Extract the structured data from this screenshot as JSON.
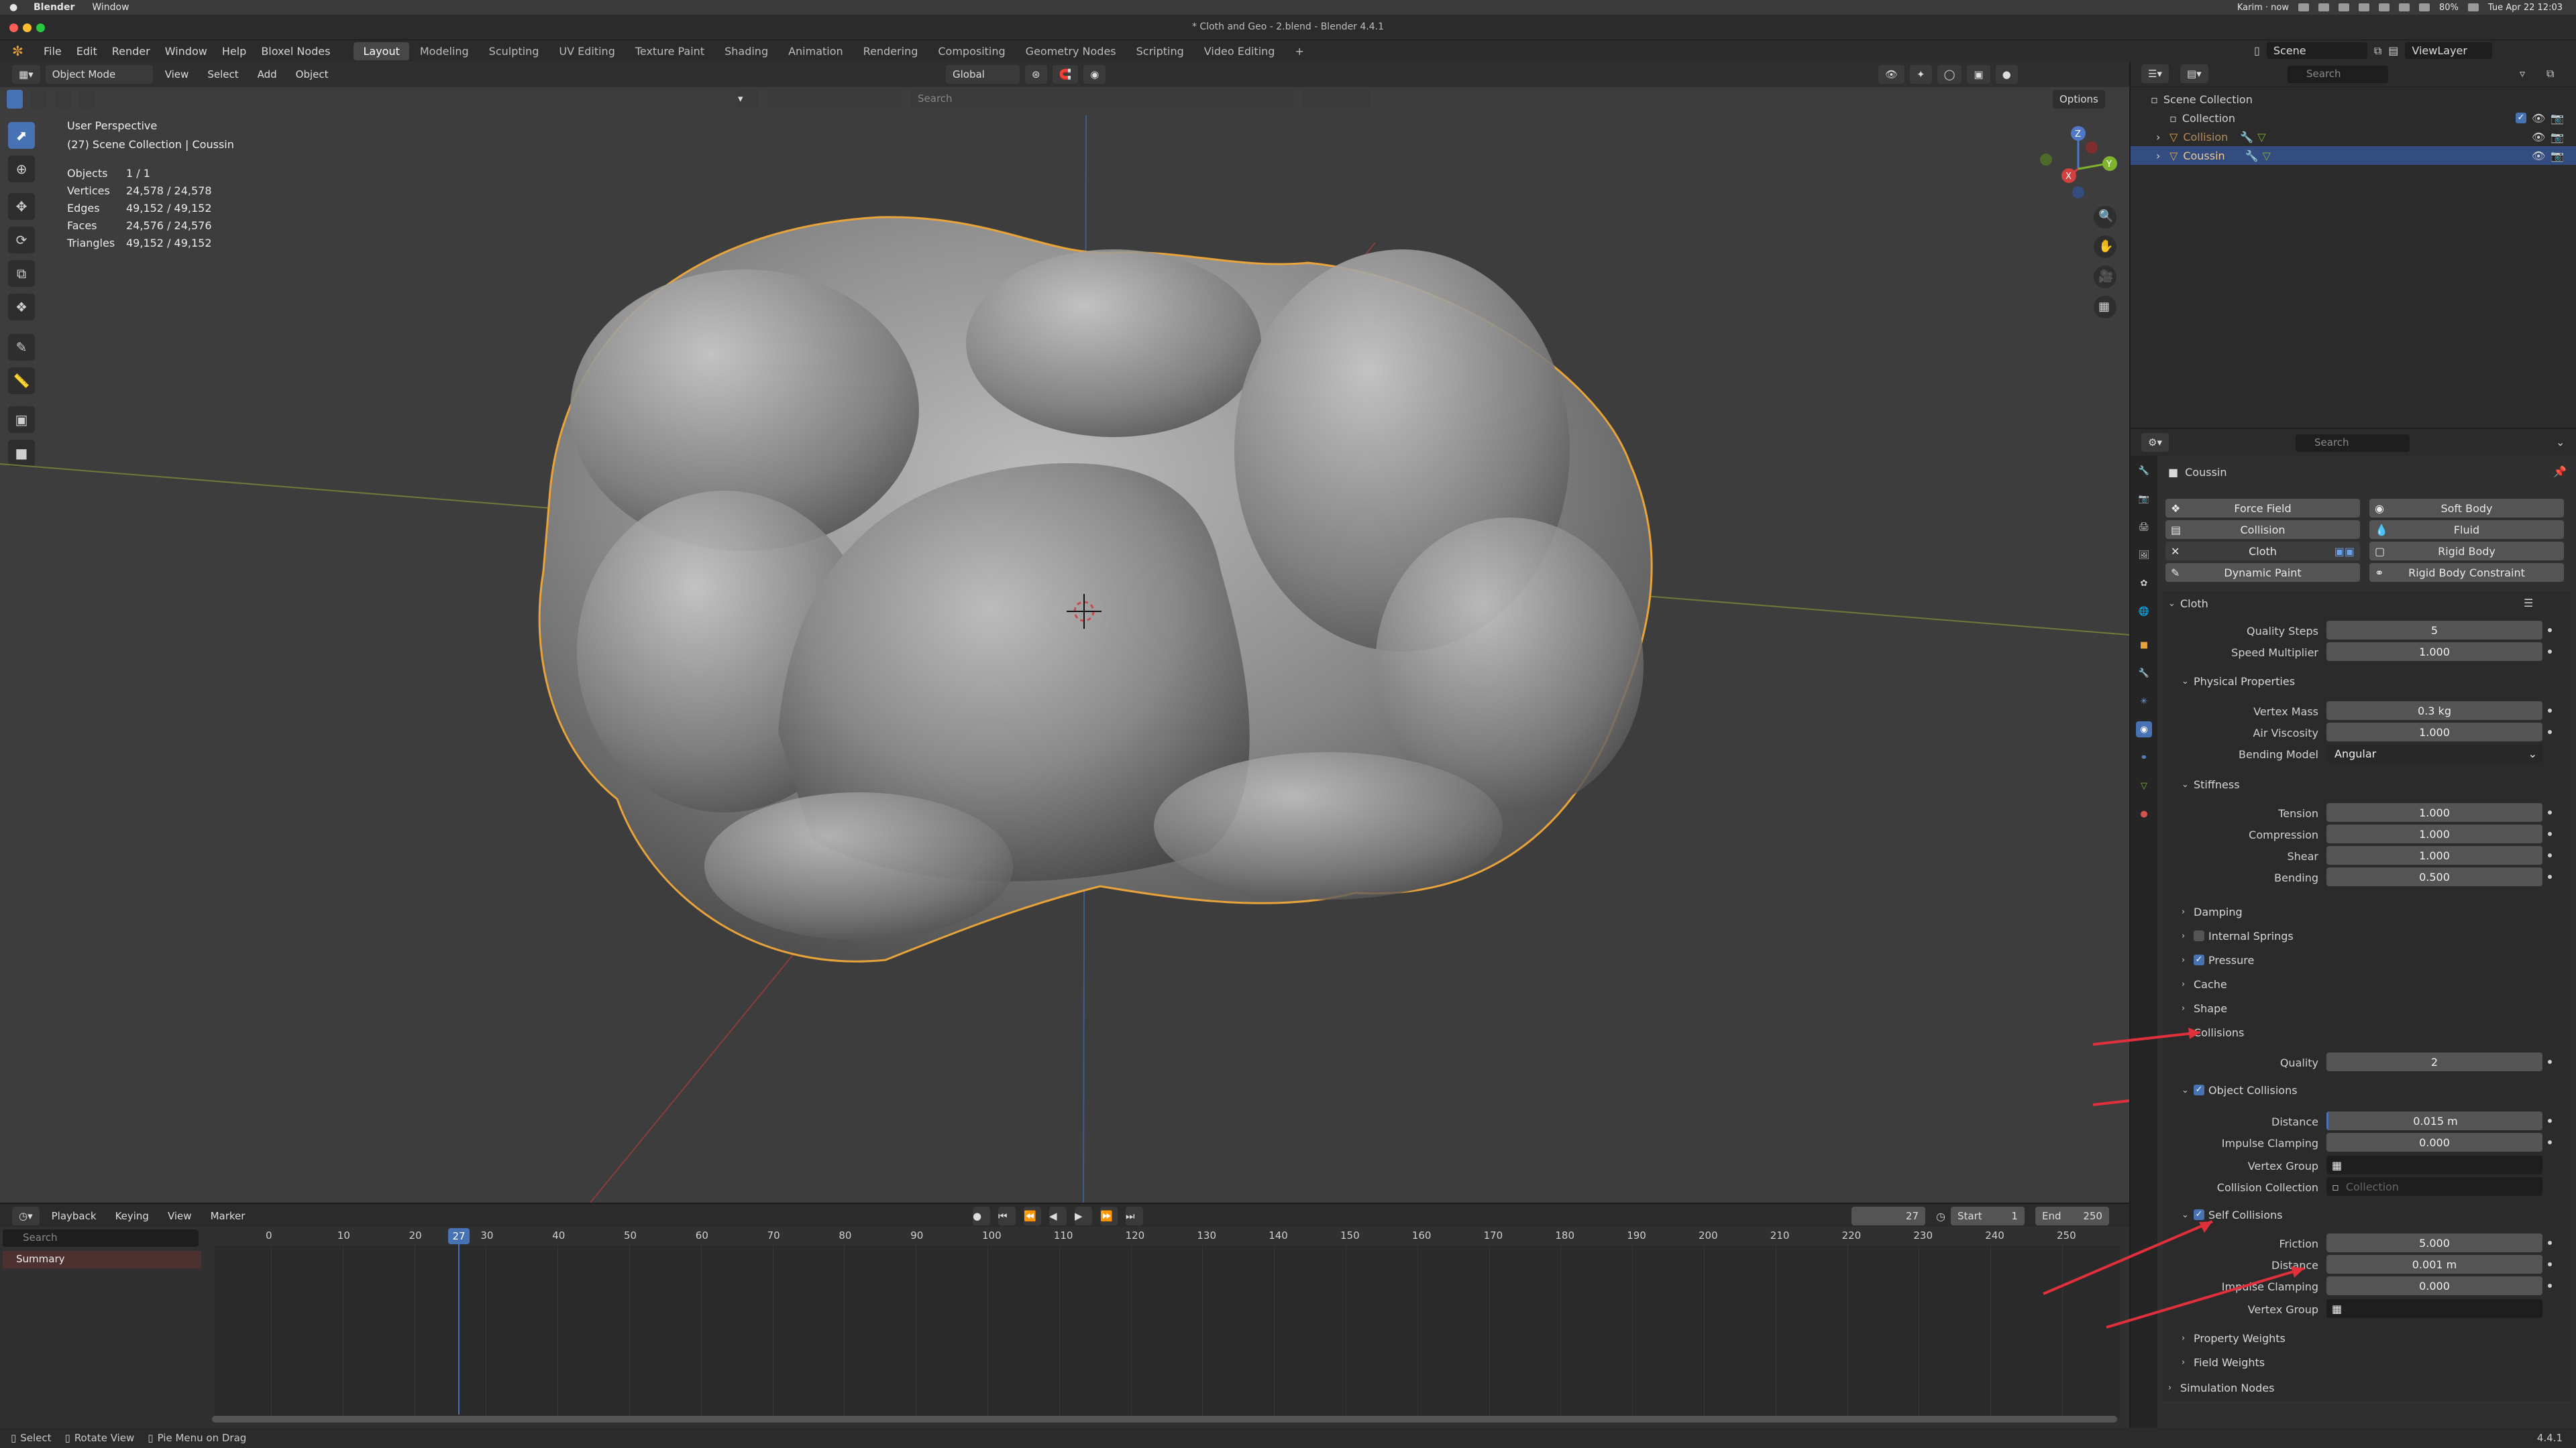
{
  "mac_menu": {
    "app": "Blender",
    "window": "Window"
  },
  "mac_status": {
    "user": "Karim · now",
    "battery": "80%",
    "datetime": "Tue Apr 22 12:03"
  },
  "window_title": "* Cloth and Geo - 2.blend - Blender 4.4.1",
  "menus": [
    "File",
    "Edit",
    "Render",
    "Window",
    "Help",
    "Bloxel Nodes"
  ],
  "workspaces": [
    "Layout",
    "Modeling",
    "Sculpting",
    "UV Editing",
    "Texture Paint",
    "Shading",
    "Animation",
    "Rendering",
    "Compositing",
    "Geometry Nodes",
    "Scripting",
    "Video Editing"
  ],
  "active_workspace": "Layout",
  "scene_field": "Scene",
  "viewlayer_field": "ViewLayer",
  "viewport": {
    "mode": "Object Mode",
    "menus": [
      "View",
      "Select",
      "Add",
      "Object"
    ],
    "transform": "Global",
    "search_placeholder": "Search",
    "options": "Options",
    "title": "User Perspective",
    "subtitle": "(27) Scene Collection | Coussin",
    "stats": [
      {
        "k": "Objects",
        "v": "1 / 1"
      },
      {
        "k": "Vertices",
        "v": "24,578 / 24,578"
      },
      {
        "k": "Edges",
        "v": "49,152 / 49,152"
      },
      {
        "k": "Faces",
        "v": "24,576 / 24,576"
      },
      {
        "k": "Triangles",
        "v": "49,152 / 49,152"
      }
    ],
    "gizmo": {
      "x": "X",
      "y": "Y",
      "z": "Z"
    }
  },
  "timeline": {
    "menus": [
      "Playback",
      "Keying",
      "View",
      "Marker"
    ],
    "current_frame": "27",
    "start_label": "Start",
    "start": "1",
    "end_label": "End",
    "end": "250",
    "search_placeholder": "Search",
    "summary": "Summary",
    "ticks": [
      "0",
      "10",
      "20",
      "30",
      "40",
      "50",
      "60",
      "70",
      "80",
      "90",
      "100",
      "110",
      "120",
      "130",
      "140",
      "150",
      "160",
      "170",
      "180",
      "190",
      "200",
      "210",
      "220",
      "230",
      "240",
      "250"
    ],
    "frame_badge": "27"
  },
  "status_bar": {
    "select": "Select",
    "rotate": "Rotate View",
    "pie": "Pie Menu on Drag",
    "version": "4.4.1"
  },
  "outliner": {
    "search_placeholder": "Search",
    "scene_collection": "Scene Collection",
    "items": [
      {
        "label": "Collection"
      },
      {
        "label": "Collision"
      },
      {
        "label": "Coussin"
      }
    ]
  },
  "properties": {
    "search_placeholder": "Search",
    "object_name": "Coussin",
    "physics_buttons": [
      [
        "Force Field",
        "Soft Body"
      ],
      [
        "Collision",
        "Fluid"
      ],
      [
        "Cloth",
        "Rigid Body"
      ],
      [
        "Dynamic Paint",
        "Rigid Body Constraint"
      ]
    ],
    "cloth_header": "Cloth",
    "quality_steps": {
      "label": "Quality Steps",
      "value": "5"
    },
    "speed_multiplier": {
      "label": "Speed Multiplier",
      "value": "1.000"
    },
    "physical_properties": "Physical Properties",
    "vertex_mass": {
      "label": "Vertex Mass",
      "value": "0.3 kg"
    },
    "air_viscosity": {
      "label": "Air Viscosity",
      "value": "1.000"
    },
    "bending_model": {
      "label": "Bending Model",
      "value": "Angular"
    },
    "stiffness": "Stiffness",
    "tension": {
      "label": "Tension",
      "value": "1.000"
    },
    "compression": {
      "label": "Compression",
      "value": "1.000"
    },
    "shear": {
      "label": "Shear",
      "value": "1.000"
    },
    "bending": {
      "label": "Bending",
      "value": "0.500"
    },
    "damping": "Damping",
    "internal_springs": "Internal Springs",
    "pressure": "Pressure",
    "cache": "Cache",
    "shape": "Shape",
    "collisions": "Collisions",
    "quality": {
      "label": "Quality",
      "value": "2"
    },
    "object_collisions": "Object Collisions",
    "oc_distance": {
      "label": "Distance",
      "value": "0.015 m"
    },
    "oc_impulse": {
      "label": "Impulse Clamping",
      "value": "0.000"
    },
    "oc_vertex_group": {
      "label": "Vertex Group"
    },
    "oc_collection": {
      "label": "Collision Collection",
      "placeholder": "Collection"
    },
    "self_collisions": "Self Collisions",
    "sc_friction": {
      "label": "Friction",
      "value": "5.000"
    },
    "sc_distance": {
      "label": "Distance",
      "value": "0.001 m"
    },
    "sc_impulse": {
      "label": "Impulse Clamping",
      "value": "0.000"
    },
    "sc_vertex_group": {
      "label": "Vertex Group"
    },
    "property_weights": "Property Weights",
    "field_weights": "Field Weights",
    "simulation_nodes": "Simulation Nodes"
  },
  "colors": {
    "accent": "#4772b3",
    "selection_outline": "#e8a33a",
    "annotation": "#e0303c"
  }
}
